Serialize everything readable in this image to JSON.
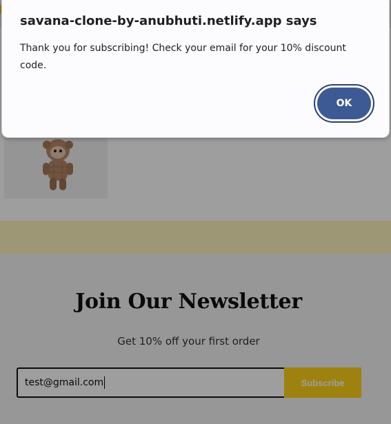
{
  "dialog": {
    "title": "savana-clone-by-anubhuti.netlify.app says",
    "message": "Thank you for subscribing! Check your email for your 10% discount code.",
    "ok_label": "OK",
    "accent": "#3d5a94"
  },
  "newsletter": {
    "title": "Join Our Newsletter",
    "subtitle": "Get 10% off your first order",
    "email_value": "test@gmail.com",
    "subscribe_label": "Subscribe",
    "button_color": "#ffd21a"
  },
  "icons": {
    "product_image": "plush-toy-image"
  }
}
